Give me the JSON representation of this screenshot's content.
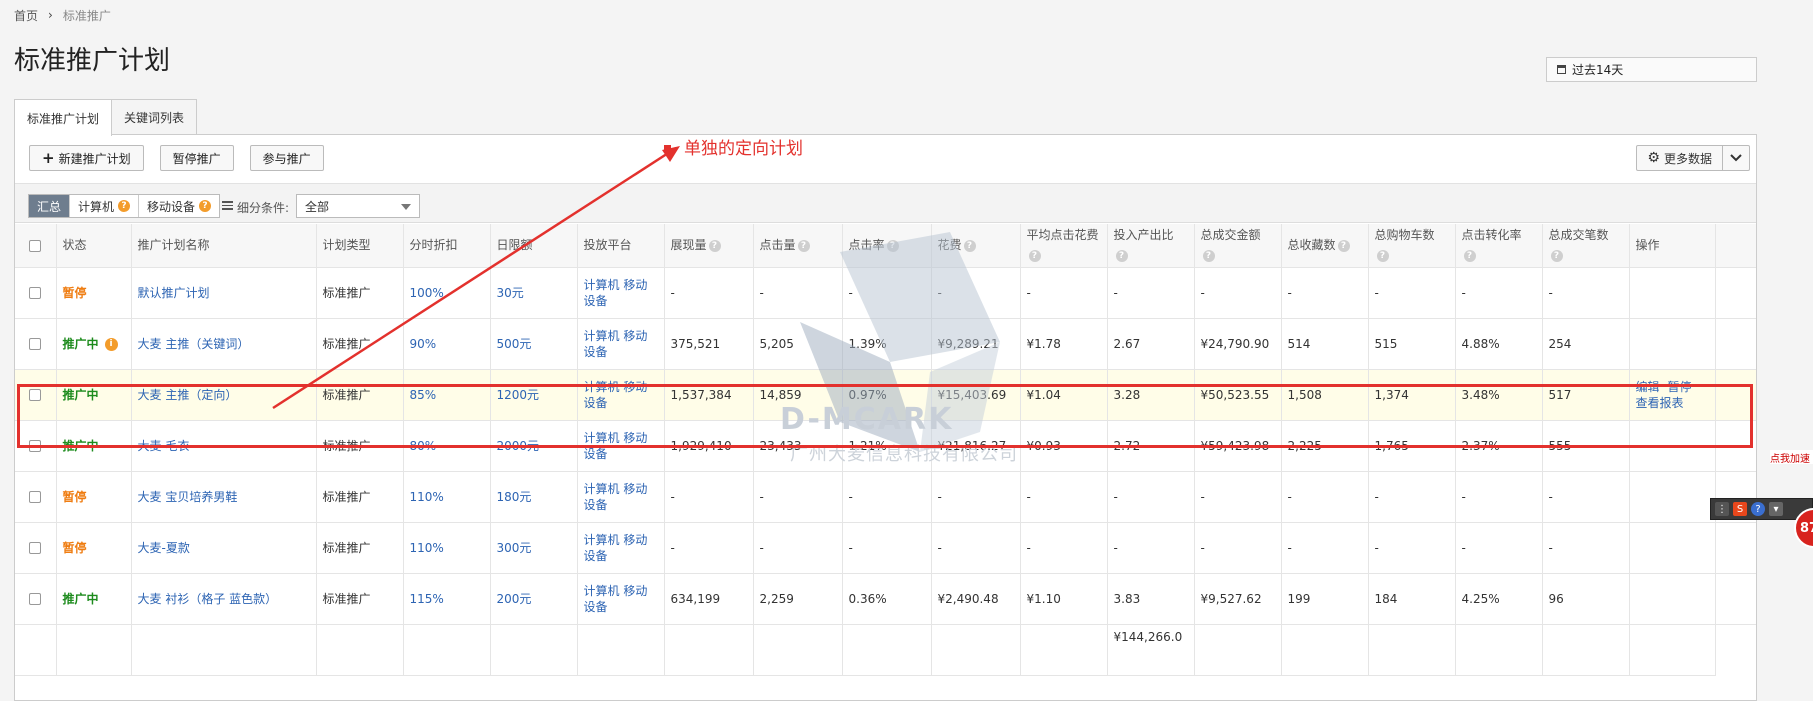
{
  "breadcrumb": {
    "home": "首页",
    "current": "标准推广"
  },
  "page_title": "标准推广计划",
  "date_range": "过去14天",
  "tabs": [
    {
      "label": "标准推广计划",
      "active": true
    },
    {
      "label": "关键词列表",
      "active": false
    }
  ],
  "toolbar": {
    "new_plan": "新建推广计划",
    "pause": "暂停推广",
    "join": "参与推广",
    "more_data": "更多数据"
  },
  "filter": {
    "segments": [
      "汇总",
      "计算机",
      "移动设备"
    ],
    "condition_label": "细分条件:",
    "condition_value": "全部"
  },
  "table": {
    "headers": [
      "状态",
      "推广计划名称",
      "计划类型",
      "分时折扣",
      "日限额",
      "投放平台",
      "展现量",
      "点击量",
      "点击率",
      "花费",
      "平均点击花费",
      "投入产出比",
      "总成交金额",
      "总收藏数",
      "总购物车数",
      "点击转化率",
      "总成交笔数",
      "操作"
    ],
    "rows": [
      {
        "status": "暂停",
        "name": "默认推广计划",
        "type": "标准推广",
        "discount": "100%",
        "limit": "30元",
        "platform": "计算机 移动设备",
        "impr": "-",
        "clicks": "-",
        "ctr": "-",
        "cost": "-",
        "cpc": "-",
        "roi": "-",
        "gmv": "-",
        "fav": "-",
        "cart": "-",
        "cvr": "-",
        "orders": "-"
      },
      {
        "status": "推广中",
        "name": "大麦 主推（关键词）",
        "type": "标准推广",
        "discount": "90%",
        "limit": "500元",
        "platform": "计算机 移动设备",
        "impr": "375,521",
        "clicks": "5,205",
        "ctr": "1.39%",
        "cost": "¥9,289.21",
        "cpc": "¥1.78",
        "roi": "2.67",
        "gmv": "¥24,790.90",
        "fav": "514",
        "cart": "515",
        "cvr": "4.88%",
        "orders": "254"
      },
      {
        "status": "推广中",
        "name": "大麦 主推（定向）",
        "type": "标准推广",
        "discount": "85%",
        "limit": "1200元",
        "platform": "计算机 移动设备",
        "impr": "1,537,384",
        "clicks": "14,859",
        "ctr": "0.97%",
        "cost": "¥15,403.69",
        "cpc": "¥1.04",
        "roi": "3.28",
        "gmv": "¥50,523.55",
        "fav": "1,508",
        "cart": "1,374",
        "cvr": "3.48%",
        "orders": "517"
      },
      {
        "status": "推广中",
        "name": "大麦 毛衣",
        "type": "标准推广",
        "discount": "80%",
        "limit": "2000元",
        "platform": "计算机 移动设备",
        "impr": "1,929,410",
        "clicks": "23,433",
        "ctr": "1.21%",
        "cost": "¥21,816.27",
        "cpc": "¥0.93",
        "roi": "2.72",
        "gmv": "¥59,423.98",
        "fav": "2,225",
        "cart": "1,765",
        "cvr": "2.37%",
        "orders": "555"
      },
      {
        "status": "暂停",
        "name": "大麦 宝贝培养男鞋",
        "type": "标准推广",
        "discount": "110%",
        "limit": "180元",
        "platform": "计算机 移动设备",
        "impr": "-",
        "clicks": "-",
        "ctr": "-",
        "cost": "-",
        "cpc": "-",
        "roi": "-",
        "gmv": "-",
        "fav": "-",
        "cart": "-",
        "cvr": "-",
        "orders": "-"
      },
      {
        "status": "暂停",
        "name": "大麦-夏款",
        "type": "标准推广",
        "discount": "110%",
        "limit": "300元",
        "platform": "计算机 移动设备",
        "impr": "-",
        "clicks": "-",
        "ctr": "-",
        "cost": "-",
        "cpc": "-",
        "roi": "-",
        "gmv": "-",
        "fav": "-",
        "cart": "-",
        "cvr": "-",
        "orders": "-"
      },
      {
        "status": "推广中",
        "name": "大麦 衬衫（格子 蓝色款）",
        "type": "标准推广",
        "discount": "115%",
        "limit": "200元",
        "platform": "计算机 移动设备",
        "impr": "634,199",
        "clicks": "2,259",
        "ctr": "0.36%",
        "cost": "¥2,490.48",
        "cpc": "¥1.10",
        "roi": "3.83",
        "gmv": "¥9,527.62",
        "fav": "199",
        "cart": "184",
        "cvr": "4.25%",
        "orders": "96"
      }
    ],
    "ops": {
      "edit": "编辑",
      "pause": "暂停",
      "report": "查看报表"
    },
    "partial_total_gmv": "¥144,266.0"
  },
  "annotation": "单独的定向计划",
  "watermark": {
    "brand": "D-MCARK",
    "company": "广州大麦信息科技有限公司"
  },
  "widget": {
    "speed": "点我加速",
    "badge": "87"
  },
  "colors": {
    "pause": "#ef7d12",
    "running": "#1d8b1d",
    "link": "#2d64b3",
    "annotation": "#e3312d"
  }
}
